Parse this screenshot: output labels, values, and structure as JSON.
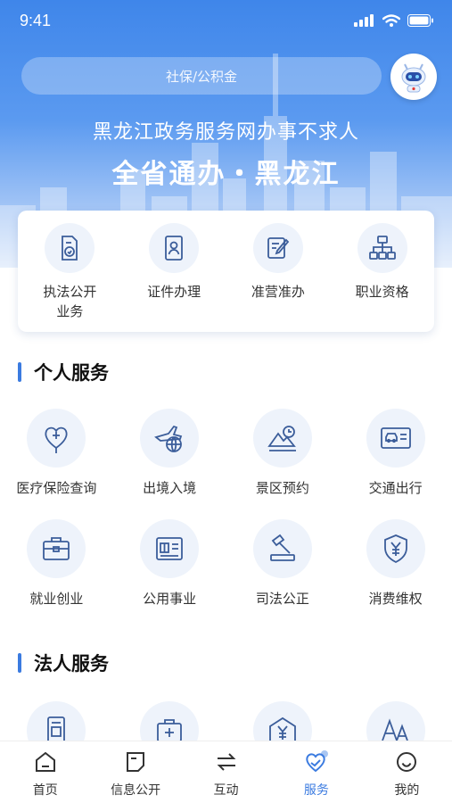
{
  "status": {
    "time": "9:41"
  },
  "search": {
    "placeholder": "社保/公积金"
  },
  "banner": {
    "line1": "黑龙江政务服务网办事不求人",
    "line2": "全省通办・黑龙江"
  },
  "quick_services": [
    {
      "label": "执法公开业务",
      "icon": "document-badge-icon"
    },
    {
      "label": "证件办理",
      "icon": "id-card-icon"
    },
    {
      "label": "准营准办",
      "icon": "pen-form-icon"
    },
    {
      "label": "职业资格",
      "icon": "org-chart-icon"
    }
  ],
  "personal": {
    "title": "个人服务",
    "items": [
      {
        "label": "医疗保险查询",
        "icon": "medical-heart-icon"
      },
      {
        "label": "出境入境",
        "icon": "airplane-globe-icon"
      },
      {
        "label": "景区预约",
        "icon": "mountain-clock-icon"
      },
      {
        "label": "交通出行",
        "icon": "car-card-icon"
      },
      {
        "label": "就业创业",
        "icon": "briefcase-icon"
      },
      {
        "label": "公用事业",
        "icon": "utility-card-icon"
      },
      {
        "label": "司法公正",
        "icon": "gavel-icon"
      },
      {
        "label": "消费维权",
        "icon": "yuan-shield-icon"
      }
    ]
  },
  "corporate": {
    "title": "法人服务",
    "items": [
      {
        "label": "",
        "icon": "phone-doc-icon"
      },
      {
        "label": "",
        "icon": "medical-kit-icon"
      },
      {
        "label": "",
        "icon": "yuan-building-icon"
      },
      {
        "label": "",
        "icon": "font-aa-icon"
      }
    ]
  },
  "tabbar": [
    {
      "label": "首页",
      "icon": "home-icon",
      "active": false
    },
    {
      "label": "信息公开",
      "icon": "info-doc-icon",
      "active": false
    },
    {
      "label": "互动",
      "icon": "exchange-icon",
      "active": false
    },
    {
      "label": "服务",
      "icon": "service-heart-icon",
      "active": true
    },
    {
      "label": "我的",
      "icon": "profile-icon",
      "active": false
    }
  ],
  "colors": {
    "accent": "#3b7be0",
    "hero_top": "#3f86ea",
    "icon_stroke": "#3b5d9a"
  }
}
